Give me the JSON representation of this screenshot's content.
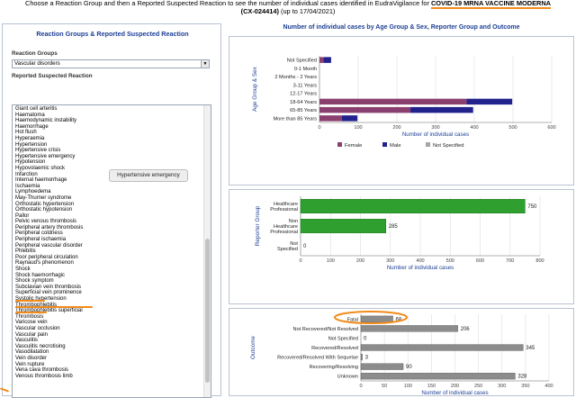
{
  "header": {
    "line1_a": "Choose a Reaction Group and then a Reported Suspected Reaction to see the number of individual cases identified in EudraVigilance for ",
    "product": "COVID-19 MRNA VACCINE MODERNA",
    "code": "(CX-024414)",
    "date_text": "(up to 17/04/2021)"
  },
  "left": {
    "title": "Reaction Groups & Reported Suspected Reaction",
    "groups_label": "Reaction Groups",
    "selected_group": "Vascular disorders",
    "reaction_label": "Reported Suspected Reaction",
    "tooltip": "Hypertensive emergency",
    "reactions": [
      "Giant cell arteritis",
      "Haematoma",
      "Haemodynamic instability",
      "Haemorrhage",
      "Hot flush",
      "Hyperaemia",
      "Hypertension",
      "Hypertensive crisis",
      "Hypertensive emergency",
      "Hypotension",
      "Hypovolaemic shock",
      "Infarction",
      "Internal haemorrhage",
      "Ischaemia",
      "Lymphoedema",
      "May-Thurner syndrome",
      "Orthostatic hypertension",
      "Orthostatic hypotension",
      "Pallor",
      "Pelvic venous thrombosis",
      "Peripheral artery thrombosis",
      "Peripheral coldness",
      "Peripheral ischaemia",
      "Peripheral vascular disorder",
      "Phlebitis",
      "Poor peripheral circulation",
      "Raynaud's phenomenon",
      "Shock",
      "Shock haemorrhagic",
      "Shock symptom",
      "Subclavian vein thrombosis",
      "Superficial vein prominence",
      "Systolic hypertension",
      "Thrombophlebitis",
      "Thrombophlebitis superficial",
      "Thrombosis",
      "Varicose vein",
      "Vascular occlusion",
      "Vascular pain",
      "Vasculitis",
      "Vasculitis necrotising",
      "Vasodilatation",
      "Vein disorder",
      "Vein rupture",
      "Vena cava thrombosis",
      "Venous thrombosis limb"
    ]
  },
  "right_title": "Number of individual cases by Age Group & Sex, Reporter Group and Outcome",
  "colors": {
    "female": "#8a3f6e",
    "male": "#22228c",
    "not_specified": "#a5a5a5",
    "green": "#2fa02f",
    "grey_bar": "#8c8c8c",
    "axis_title": "#1c3f94"
  },
  "chart_data": [
    {
      "type": "bar",
      "orientation": "horizontal",
      "stacked": true,
      "ylabel": "Age Group & Sex",
      "xlabel": "Number of individual cases",
      "xlim": [
        0,
        600
      ],
      "xticks": [
        0,
        100,
        200,
        300,
        400,
        500,
        600
      ],
      "categories": [
        "Not Specified",
        "0-1 Month",
        "2 Months - 2 Years",
        "3-11 Years",
        "12-17 Years",
        "18-64 Years",
        "65-85 Years",
        "More than 85 Years"
      ],
      "series": [
        {
          "name": "Female",
          "values": [
            10,
            0,
            0,
            0,
            0,
            380,
            235,
            58
          ]
        },
        {
          "name": "Male",
          "values": [
            20,
            0,
            0,
            0,
            0,
            118,
            162,
            40
          ]
        },
        {
          "name": "Not Specified",
          "values": [
            0,
            0,
            0,
            0,
            0,
            0,
            0,
            0
          ]
        }
      ]
    },
    {
      "type": "bar",
      "orientation": "horizontal",
      "ylabel": "Reporter Group",
      "xlabel": "Number of individual cases",
      "xlim": [
        0,
        800
      ],
      "xticks": [
        0,
        100,
        200,
        300,
        400,
        500,
        600,
        700,
        800
      ],
      "categories": [
        "Healthcare Professional",
        "Non Healthcare Professional",
        "Not Specified"
      ],
      "category_lines": [
        [
          "Healthcare",
          "Professional"
        ],
        [
          "Non",
          "Healthcare",
          "Professional"
        ],
        [
          "Not",
          "Specified"
        ]
      ],
      "values": [
        750,
        285,
        0
      ]
    },
    {
      "type": "bar",
      "orientation": "horizontal",
      "ylabel": "Outcome",
      "xlabel": "Number of individual cases",
      "xlim": [
        0,
        400
      ],
      "xticks": [
        0,
        50,
        100,
        150,
        200,
        250,
        300,
        350,
        400
      ],
      "categories": [
        "Fatal",
        "Not Recovered/Not Resolved",
        "Not Specified",
        "Recovered/Resolved",
        "Recovered/Resolved With Sequelae",
        "Recovering/Resolving",
        "Unknown"
      ],
      "values": [
        68,
        206,
        0,
        345,
        3,
        90,
        328
      ]
    }
  ]
}
